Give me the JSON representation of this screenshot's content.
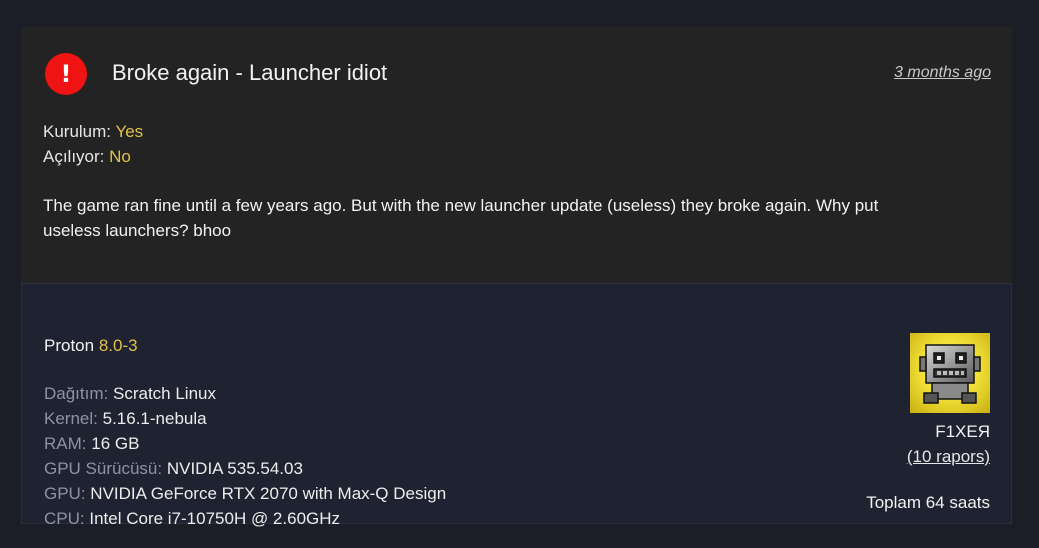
{
  "report": {
    "title": "Broke again - Launcher idiot",
    "timestamp": "3 months ago",
    "fields": [
      {
        "label": "Kurulum:",
        "value": "Yes"
      },
      {
        "label": "Açılıyor:",
        "value": "No"
      }
    ],
    "body": "The game ran fine until a few years ago. But with the new launcher update (useless) they broke again. Why put useless launchers? bhoo",
    "alert_icon": "exclamation-icon",
    "alert_symbol": "!"
  },
  "system": {
    "proton_label": "Proton",
    "proton_version": "8.0-3",
    "specs": [
      {
        "label": "Dağıtım:",
        "value": "Scratch Linux"
      },
      {
        "label": "Kernel:",
        "value": "5.16.1-nebula"
      },
      {
        "label": "RAM:",
        "value": "16 GB"
      },
      {
        "label": "GPU Sürücüsü:",
        "value": "NVIDIA 535.54.03"
      },
      {
        "label": "GPU:",
        "value": "NVIDIA GeForce RTX 2070 with Max-Q Design"
      },
      {
        "label": "CPU:",
        "value": "Intel Core i7-10750H @ 2.60GHz"
      }
    ]
  },
  "user": {
    "name": "F1XEЯ",
    "reports_link": "(10 rapors)",
    "playtime": "Toplam 64 saats",
    "avatar_icon": "robot-avatar"
  },
  "colors": {
    "accent_value": "#e3c14a",
    "alert": "#f01313",
    "background": "#1b1e27"
  }
}
